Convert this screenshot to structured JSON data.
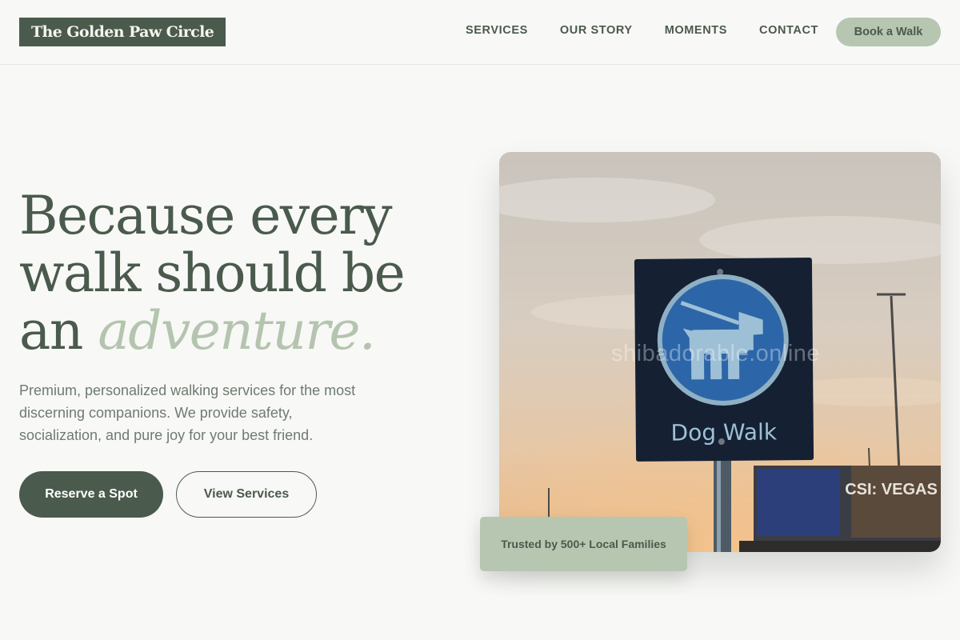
{
  "brand": {
    "logo_text": "The Golden Paw Circle"
  },
  "nav": {
    "links": [
      "SERVICES",
      "OUR STORY",
      "MOMENTS",
      "CONTACT"
    ],
    "cta_label": "Book a Walk"
  },
  "hero": {
    "headline_line1": "Because every",
    "headline_line2": "walk should be",
    "headline_line3_plain": "an",
    "headline_line3_accent": "adventure.",
    "subtext": "Premium, personalized walking services for the most discerning companions. We provide safety, socialization, and pure joy for your best friend.",
    "primary_button": "Reserve a Spot",
    "secondary_button": "View Services"
  },
  "photo": {
    "sign_text": "Dog Walk",
    "billboard_text": "CSI: VEGAS",
    "watermark": "shibadorable.online"
  },
  "trust_badge": {
    "text": "Trusted by 500+ Local Families"
  },
  "colors": {
    "primary": "#4a5a4c",
    "accent": "#b7c6b1",
    "background": "#f8f8f6"
  }
}
